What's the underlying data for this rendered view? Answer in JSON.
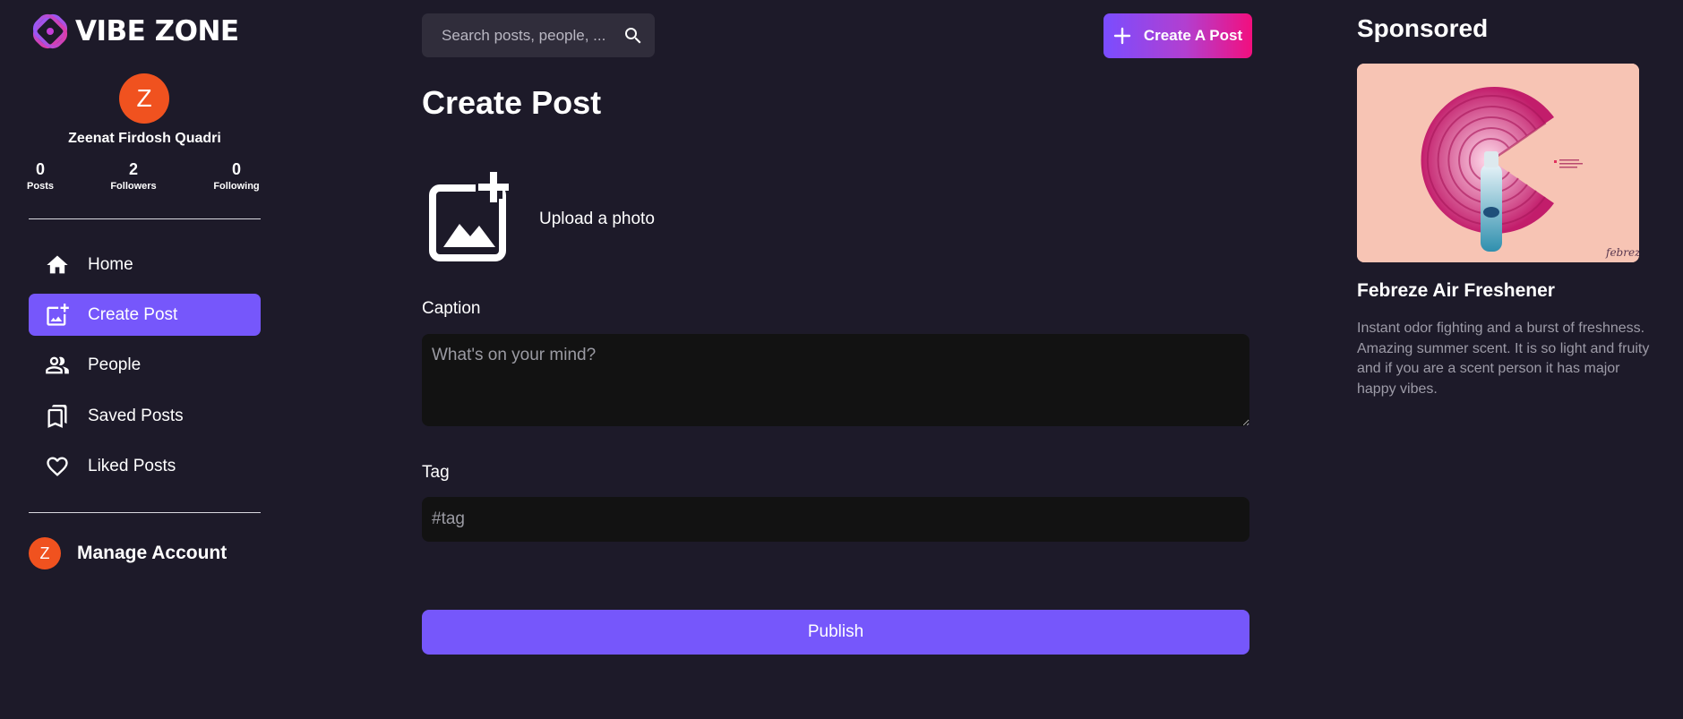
{
  "app": {
    "name": "VIBE ZONE"
  },
  "profile": {
    "initial": "Z",
    "name": "Zeenat Firdosh Quadri",
    "stats": [
      {
        "value": "0",
        "label": "Posts"
      },
      {
        "value": "2",
        "label": "Followers"
      },
      {
        "value": "0",
        "label": "Following"
      }
    ]
  },
  "nav": {
    "items": [
      {
        "label": "Home",
        "icon": "home-icon"
      },
      {
        "label": "Create Post",
        "icon": "add-photo-icon",
        "active": true
      },
      {
        "label": "People",
        "icon": "people-icon"
      },
      {
        "label": "Saved Posts",
        "icon": "bookmarks-icon"
      },
      {
        "label": "Liked Posts",
        "icon": "heart-icon"
      }
    ]
  },
  "manage": {
    "initial": "Z",
    "label": "Manage Account"
  },
  "search": {
    "placeholder": "Search posts, people, ..."
  },
  "create_button": {
    "label": "Create A Post"
  },
  "page": {
    "title": "Create Post",
    "upload_label": "Upload a photo",
    "caption_label": "Caption",
    "caption_placeholder": "What's on your mind?",
    "tag_label": "Tag",
    "tag_placeholder": "#tag",
    "publish_label": "Publish"
  },
  "sponsored": {
    "heading": "Sponsored",
    "ad_title": "Febreze Air Freshener",
    "ad_brand": "febreze",
    "ad_description": "Instant odor fighting and a burst of freshness. Amazing summer scent. It is so light and fruity and if you are a scent person it has major happy vibes."
  },
  "colors": {
    "background": "#1d1a29",
    "accent": "#7657fb",
    "avatar": "#f0521f",
    "input_bg": "#121212",
    "gradient_start": "#7a4dff",
    "gradient_end": "#f20f7e"
  }
}
